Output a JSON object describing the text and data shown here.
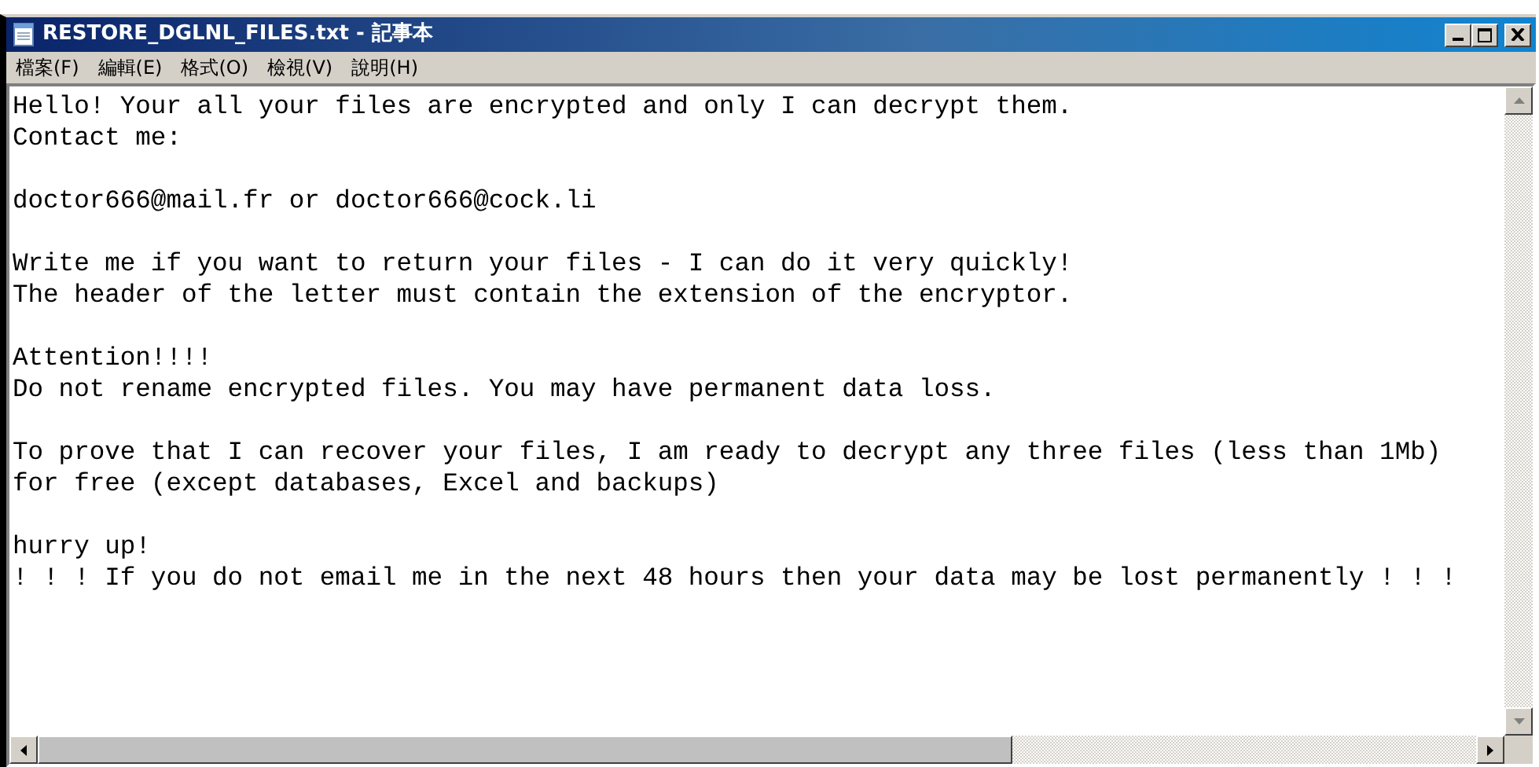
{
  "window": {
    "title": "RESTORE_DGLNL_FILES.txt - 記事本"
  },
  "menu": [
    "檔案(F)",
    "編輯(E)",
    "格式(O)",
    "檢視(V)",
    "說明(H)"
  ],
  "paragraphs": [
    [
      "Hello! Your all your files are encrypted and only I can decrypt them.",
      "Contact me:"
    ],
    [
      "doctor666@mail.fr or doctor666@cock.li"
    ],
    [
      "Write me if you want to return your files - I can do it very quickly!",
      "The header of the letter must contain the extension of the encryptor."
    ],
    [
      "Attention!!!!",
      "Do not rename encrypted files. You may have permanent data loss."
    ],
    [
      "To prove that I can recover your files, I am ready to decrypt any three files (less than 1Mb)",
      "for free (except databases, Excel and backups)"
    ],
    [
      "hurry up!",
      "! ! ! If you do not email me in the next 48 hours then your data may be lost permanently ! ! !"
    ]
  ]
}
